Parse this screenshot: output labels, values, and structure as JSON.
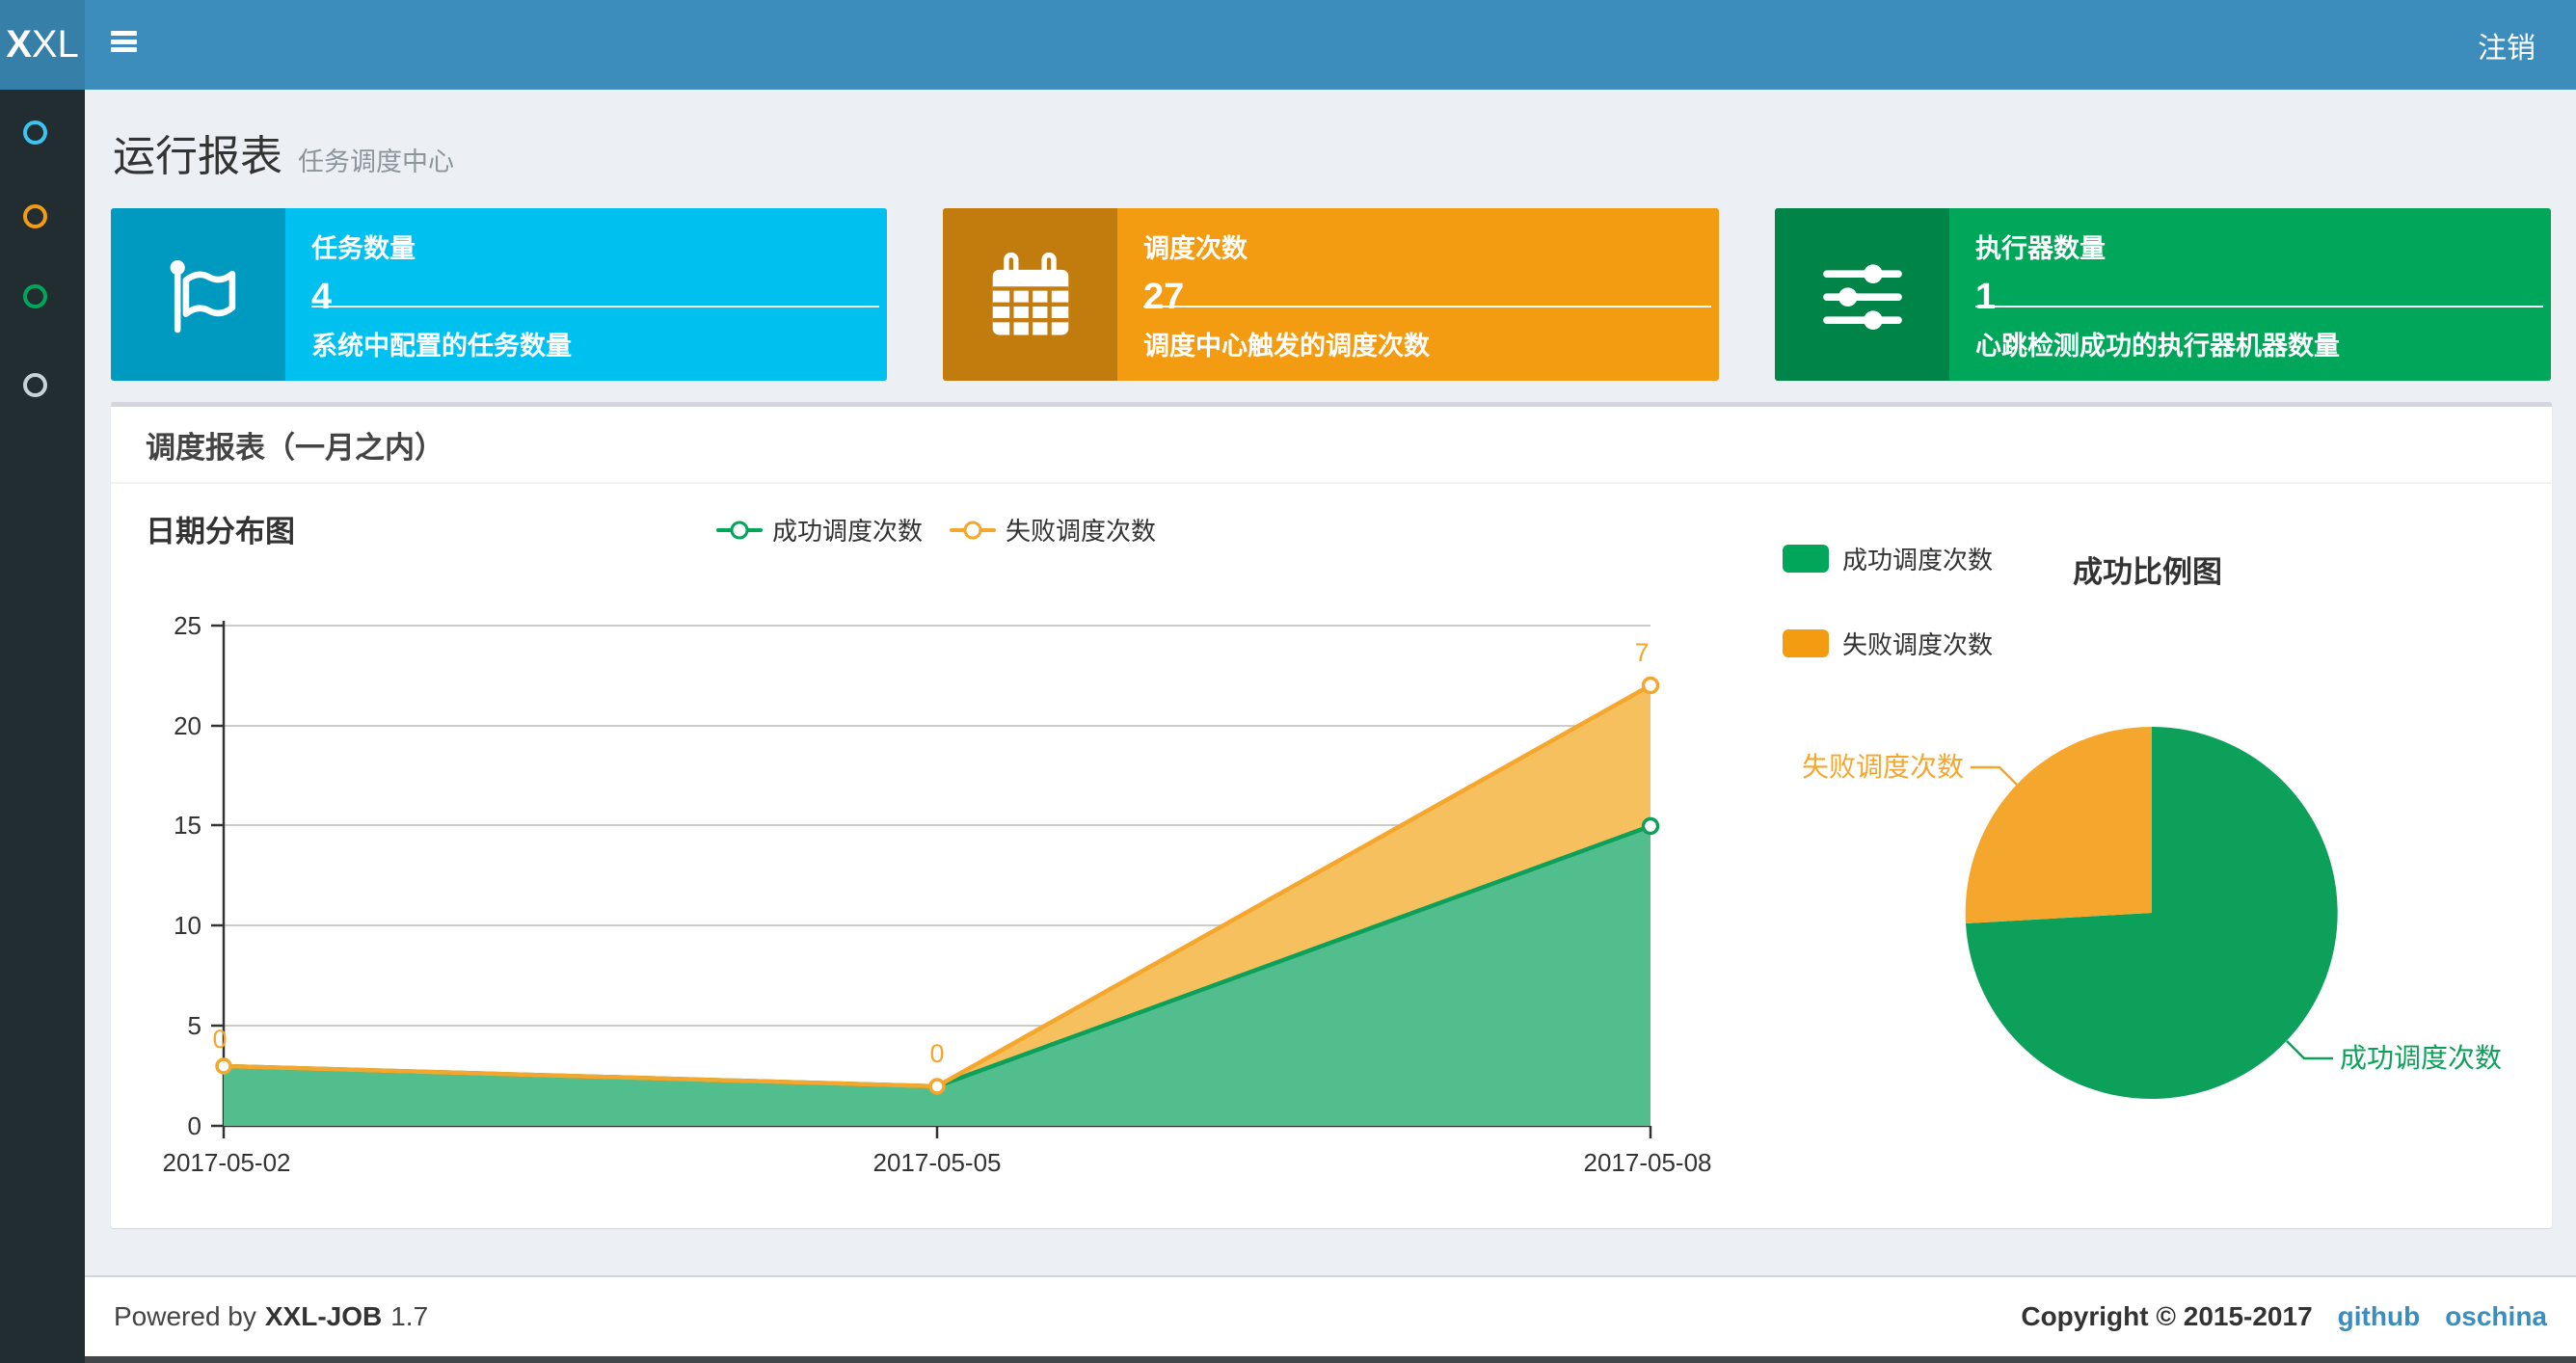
{
  "header": {
    "logo_bold": "X",
    "logo_rest": "XL",
    "logout_label": "注销"
  },
  "sidebar": {
    "items": [
      {
        "icon": "circle-o-icon",
        "color": "#3cc4ef"
      },
      {
        "icon": "circle-o-icon",
        "color": "#f39c12"
      },
      {
        "icon": "circle-o-icon",
        "color": "#00a65a"
      },
      {
        "icon": "circle-o-icon",
        "color": "#c8d2d8"
      }
    ]
  },
  "page": {
    "title": "运行报表",
    "subtitle": "任务调度中心"
  },
  "info_boxes": [
    {
      "title": "任务数量",
      "value": "4",
      "caption": "系统中配置的任务数量",
      "color": "#00c0ef",
      "icon": "flag-icon"
    },
    {
      "title": "调度次数",
      "value": "27",
      "caption": "调度中心触发的调度次数",
      "color": "#f39c12",
      "icon": "calendar-icon"
    },
    {
      "title": "执行器数量",
      "value": "1",
      "caption": "心跳检测成功的执行器机器数量",
      "color": "#00a65a",
      "icon": "sliders-icon"
    }
  ],
  "panel": {
    "title": "调度报表（一月之内）"
  },
  "chart_data": [
    {
      "type": "area",
      "title": "日期分布图",
      "x": [
        "2017-05-02",
        "2017-05-05",
        "2017-05-08"
      ],
      "yticks": [
        "0",
        "5",
        "10",
        "15",
        "20",
        "25"
      ],
      "ylim": [
        0,
        25
      ],
      "grid": true,
      "stacked": true,
      "legend_position": "top-center",
      "series": [
        {
          "name": "成功调度次数",
          "values": [
            3,
            2,
            15
          ],
          "color": "#00a65a"
        },
        {
          "name": "失败调度次数",
          "values": [
            0,
            0,
            7
          ],
          "stacked_totals": [
            3,
            2,
            22
          ],
          "color": "#f39c12",
          "point_labels": [
            "0",
            "0",
            "7"
          ]
        }
      ]
    },
    {
      "type": "pie",
      "title": "成功比例图",
      "legend_position": "left",
      "slices": [
        {
          "label": "成功调度次数",
          "value": 20,
          "color": "#00a65a"
        },
        {
          "label": "失败调度次数",
          "value": 7,
          "color": "#f39c12"
        }
      ]
    }
  ],
  "footer": {
    "powered_by": "Powered by",
    "product": "XXL-JOB",
    "version": "1.7",
    "copyright": "Copyright © 2015-2017",
    "links": [
      {
        "label": "github"
      },
      {
        "label": "oschina"
      }
    ]
  }
}
